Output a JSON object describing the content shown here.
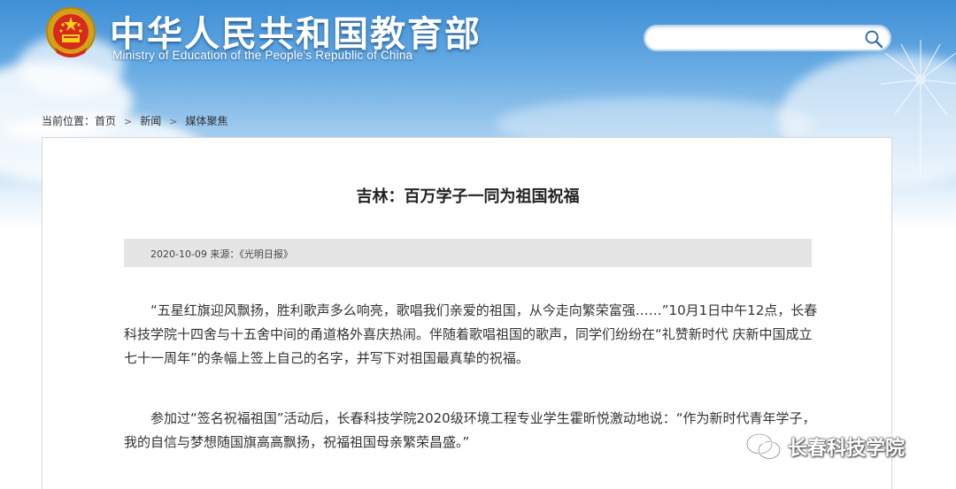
{
  "header": {
    "title": "中华人民共和国教育部",
    "subtitle": "Ministry of Education of the People's Republic of China"
  },
  "search": {
    "placeholder": "",
    "value": ""
  },
  "breadcrumb": {
    "prefix": "当前位置：",
    "items": [
      "首页",
      "新闻",
      "媒体聚焦"
    ]
  },
  "article": {
    "title": "吉林：百万学子一同为祖国祝福",
    "meta": "2020-10-09  来源：《光明日报》",
    "paragraphs": [
      "“五星红旗迎风飘扬，胜利歌声多么响亮，歌唱我们亲爱的祖国，从今走向繁荣富强……”10月1日中午12点，长春科技学院十四舍与十五舍中间的甬道格外喜庆热闹。伴随着歌唱祖国的歌声，同学们纷纷在“礼赞新时代 庆新中国成立七十一周年”的条幅上签上自己的名字，并写下对祖国最真挚的祝福。",
      "参加过“签名祝福祖国”活动后，长春科技学院2020级环境工程专业学生霍昕悦激动地说：“作为新时代青年学子，我的自信与梦想随国旗高高飘扬，祝福祖国母亲繁荣昌盛。”"
    ]
  },
  "watermark": {
    "text": "长春科技学院",
    "icon": "wechat-icon"
  },
  "colors": {
    "sky_top": "#3f8fd6",
    "title_text": "#ffffff",
    "meta_bar": "#e5e5e5",
    "body_text": "#333333"
  }
}
